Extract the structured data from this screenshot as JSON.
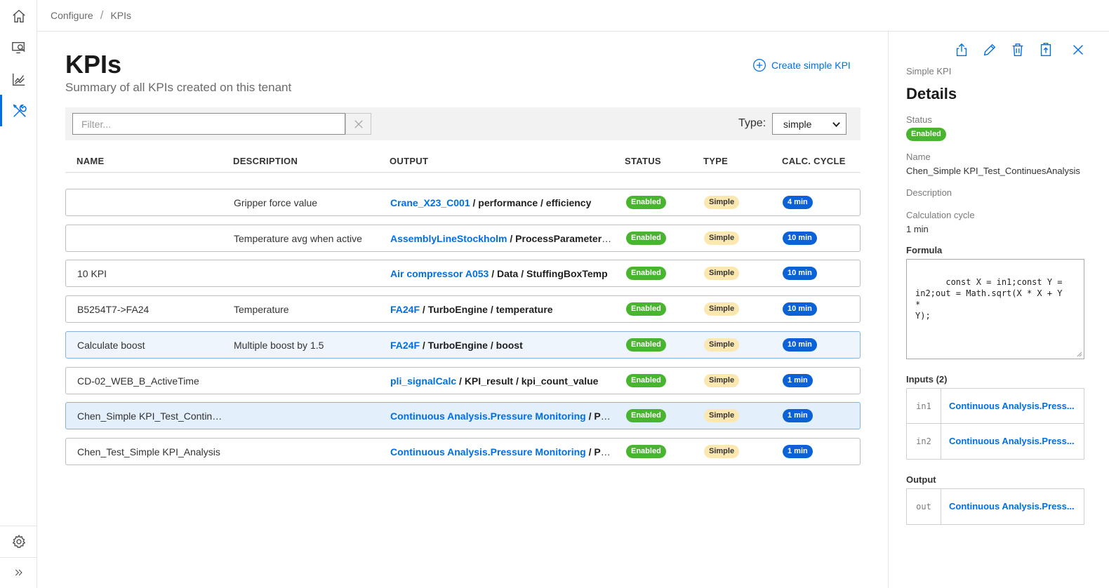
{
  "nav": {
    "items": [
      {
        "name": "home"
      },
      {
        "name": "monitor"
      },
      {
        "name": "analytics"
      },
      {
        "name": "configure",
        "active": true
      }
    ],
    "settings": "settings",
    "expand": "expand"
  },
  "breadcrumb": {
    "items": [
      "Configure",
      "KPIs"
    ],
    "separator": "/"
  },
  "page": {
    "title": "KPIs",
    "subtitle": "Summary of all KPIs created on this tenant",
    "create_label": "Create simple KPI"
  },
  "filter": {
    "placeholder": "Filter...",
    "value": "",
    "type_label": "Type:",
    "type_value": "simple"
  },
  "table": {
    "headers": [
      "NAME",
      "DESCRIPTION",
      "OUTPUT",
      "STATUS",
      "TYPE",
      "CALC. CYCLE"
    ],
    "rows": [
      {
        "name": "",
        "description": "Gripper force value",
        "output_link": "Crane_X23_C001",
        "output_rest": " / performance / efficiency",
        "status": "Enabled",
        "type": "Simple",
        "cycle": "4 min"
      },
      {
        "name": "",
        "description": "Temperature avg when active",
        "output_link": "AssemblyLineStockholm",
        "output_rest": " / ProcessParameter / T...",
        "status": "Enabled",
        "type": "Simple",
        "cycle": "10 min"
      },
      {
        "name": "10 KPI",
        "description": "",
        "output_link": "Air compressor A053",
        "output_rest": " / Data / StuffingBoxTemp",
        "status": "Enabled",
        "type": "Simple",
        "cycle": "10 min"
      },
      {
        "name": "B5254T7->FA24",
        "description": "Temperature",
        "output_link": "FA24F",
        "output_rest": " / TurboEngine / temperature",
        "status": "Enabled",
        "type": "Simple",
        "cycle": "10 min"
      },
      {
        "name": "Calculate boost",
        "description": "Multiple boost by 1.5",
        "output_link": "FA24F",
        "output_rest": " / TurboEngine / boost",
        "status": "Enabled",
        "type": "Simple",
        "cycle": "10 min",
        "state": "hover"
      },
      {
        "name": "CD-02_WEB_B_ActiveTime",
        "description": "",
        "output_link": "pli_signalCalc",
        "output_rest": " / KPI_result / kpi_count_value",
        "status": "Enabled",
        "type": "Simple",
        "cycle": "1 min"
      },
      {
        "name": "Chen_Simple KPI_Test_Continu...",
        "description": "",
        "output_link": "Continuous Analysis.Pressure Monitoring",
        "output_rest": " / Pres...",
        "status": "Enabled",
        "type": "Simple",
        "cycle": "1 min",
        "state": "selected"
      },
      {
        "name": "Chen_Test_Simple KPI_Analysis",
        "description": "",
        "output_link": "Continuous Analysis.Pressure Monitoring",
        "output_rest": " / Pres...",
        "status": "Enabled",
        "type": "Simple",
        "cycle": "1 min"
      }
    ]
  },
  "details": {
    "kind": "Simple KPI",
    "title": "Details",
    "status_label": "Status",
    "status_value": "Enabled",
    "name_label": "Name",
    "name_value": "Chen_Simple KPI_Test_ContinuesAnalysis",
    "description_label": "Description",
    "cycle_label": "Calculation cycle",
    "cycle_value": "1 min",
    "formula_label": "Formula",
    "formula_value": "  const X = in1;const Y = \nin2;out = Math.sqrt(X * X + Y \n* \nY);",
    "inputs_label": "Inputs (2)",
    "inputs": [
      {
        "key": "in1",
        "value": "Continuous Analysis.Press..."
      },
      {
        "key": "in2",
        "value": "Continuous Analysis.Press..."
      }
    ],
    "output_label": "Output",
    "output": {
      "key": "out",
      "value": "Continuous Analysis.Press..."
    }
  },
  "colors": {
    "accent": "#006fe6",
    "enabled": "#47b52d",
    "simple": "#fbe7b0",
    "cycle": "#0b62d6",
    "selected_row": "#e3effb"
  }
}
